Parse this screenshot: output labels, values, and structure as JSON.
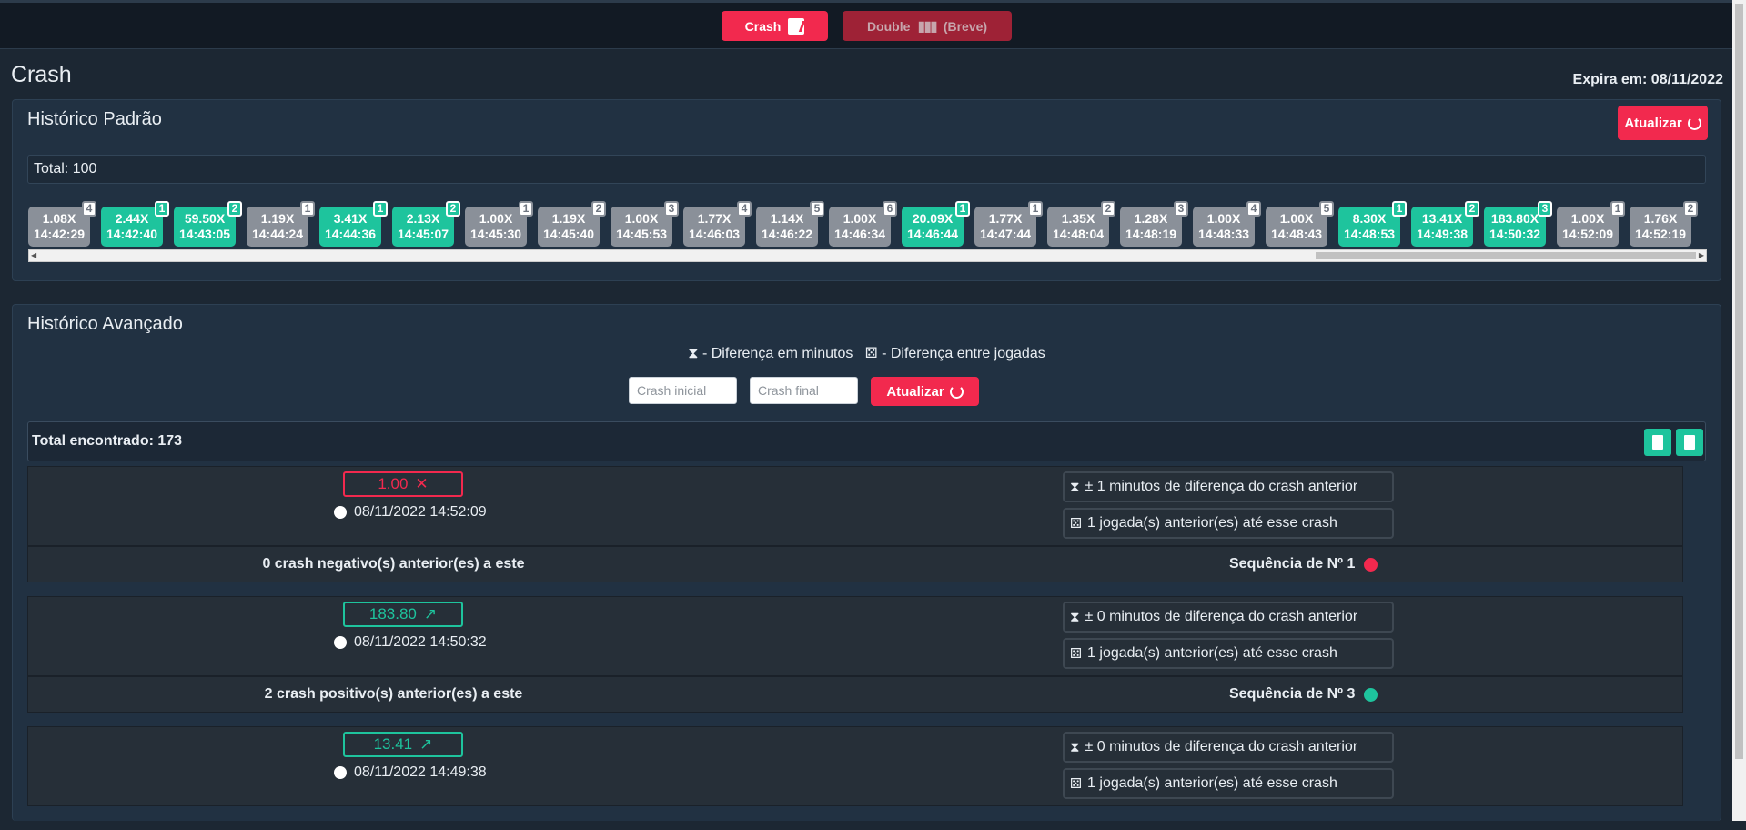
{
  "nav": {
    "crash_label": "Crash",
    "double_label": "Double",
    "double_note": "(Breve)"
  },
  "page": {
    "title": "Crash",
    "expires": "Expira em: 08/11/2022"
  },
  "historico_padrao": {
    "title": "Histórico Padrão",
    "refresh_label": "Atualizar",
    "total": "Total: 100",
    "chips": [
      {
        "value": "1.08X",
        "time": "14:42:29",
        "badge": "4",
        "kind": "gray"
      },
      {
        "value": "2.44X",
        "time": "14:42:40",
        "badge": "1",
        "kind": "green"
      },
      {
        "value": "59.50X",
        "time": "14:43:05",
        "badge": "2",
        "kind": "green"
      },
      {
        "value": "1.19X",
        "time": "14:44:24",
        "badge": "1",
        "kind": "gray"
      },
      {
        "value": "3.41X",
        "time": "14:44:36",
        "badge": "1",
        "kind": "green"
      },
      {
        "value": "2.13X",
        "time": "14:45:07",
        "badge": "2",
        "kind": "green"
      },
      {
        "value": "1.00X",
        "time": "14:45:30",
        "badge": "1",
        "kind": "gray"
      },
      {
        "value": "1.19X",
        "time": "14:45:40",
        "badge": "2",
        "kind": "gray"
      },
      {
        "value": "1.00X",
        "time": "14:45:53",
        "badge": "3",
        "kind": "gray"
      },
      {
        "value": "1.77X",
        "time": "14:46:03",
        "badge": "4",
        "kind": "gray"
      },
      {
        "value": "1.14X",
        "time": "14:46:22",
        "badge": "5",
        "kind": "gray"
      },
      {
        "value": "1.00X",
        "time": "14:46:34",
        "badge": "6",
        "kind": "gray"
      },
      {
        "value": "20.09X",
        "time": "14:46:44",
        "badge": "1",
        "kind": "green"
      },
      {
        "value": "1.77X",
        "time": "14:47:44",
        "badge": "1",
        "kind": "gray"
      },
      {
        "value": "1.35X",
        "time": "14:48:04",
        "badge": "2",
        "kind": "gray"
      },
      {
        "value": "1.28X",
        "time": "14:48:19",
        "badge": "3",
        "kind": "gray"
      },
      {
        "value": "1.00X",
        "time": "14:48:33",
        "badge": "4",
        "kind": "gray"
      },
      {
        "value": "1.00X",
        "time": "14:48:43",
        "badge": "5",
        "kind": "gray"
      },
      {
        "value": "8.30X",
        "time": "14:48:53",
        "badge": "1",
        "kind": "green"
      },
      {
        "value": "13.41X",
        "time": "14:49:38",
        "badge": "2",
        "kind": "green"
      },
      {
        "value": "183.80X",
        "time": "14:50:32",
        "badge": "3",
        "kind": "green"
      },
      {
        "value": "1.00X",
        "time": "14:52:09",
        "badge": "1",
        "kind": "gray"
      },
      {
        "value": "1.76X",
        "time": "14:52:19",
        "badge": "2",
        "kind": "gray"
      }
    ]
  },
  "historico_avancado": {
    "title": "Histórico Avançado",
    "legend_minutes": "- Diferença em minutos",
    "legend_plays": "- Diferença entre jogadas",
    "crash_inicial_placeholder": "Crash inicial",
    "crash_final_placeholder": "Crash final",
    "refresh_label": "Atualizar",
    "total_found": "Total encontrado: 173",
    "records": [
      {
        "value": "1.00",
        "kind": "neg",
        "datetime": "08/11/2022 14:52:09",
        "minutes": "± 1 minutos de diferença do crash anterior",
        "plays": "1 jogada(s) anterior(es) até esse crash",
        "summary": "0 crash negativo(s) anterior(es) a este",
        "sequence": "Sequência de Nº 1"
      },
      {
        "value": "183.80",
        "kind": "pos",
        "datetime": "08/11/2022 14:50:32",
        "minutes": "± 0 minutos de diferença do crash anterior",
        "plays": "1 jogada(s) anterior(es) até esse crash",
        "summary": "2 crash positivo(s) anterior(es) a este",
        "sequence": "Sequência de Nº 3"
      },
      {
        "value": "13.41",
        "kind": "pos",
        "datetime": "08/11/2022 14:49:38",
        "minutes": "± 0 minutos de diferença do crash anterior",
        "plays": "1 jogada(s) anterior(es) até esse crash",
        "summary": "",
        "sequence": ""
      }
    ]
  }
}
